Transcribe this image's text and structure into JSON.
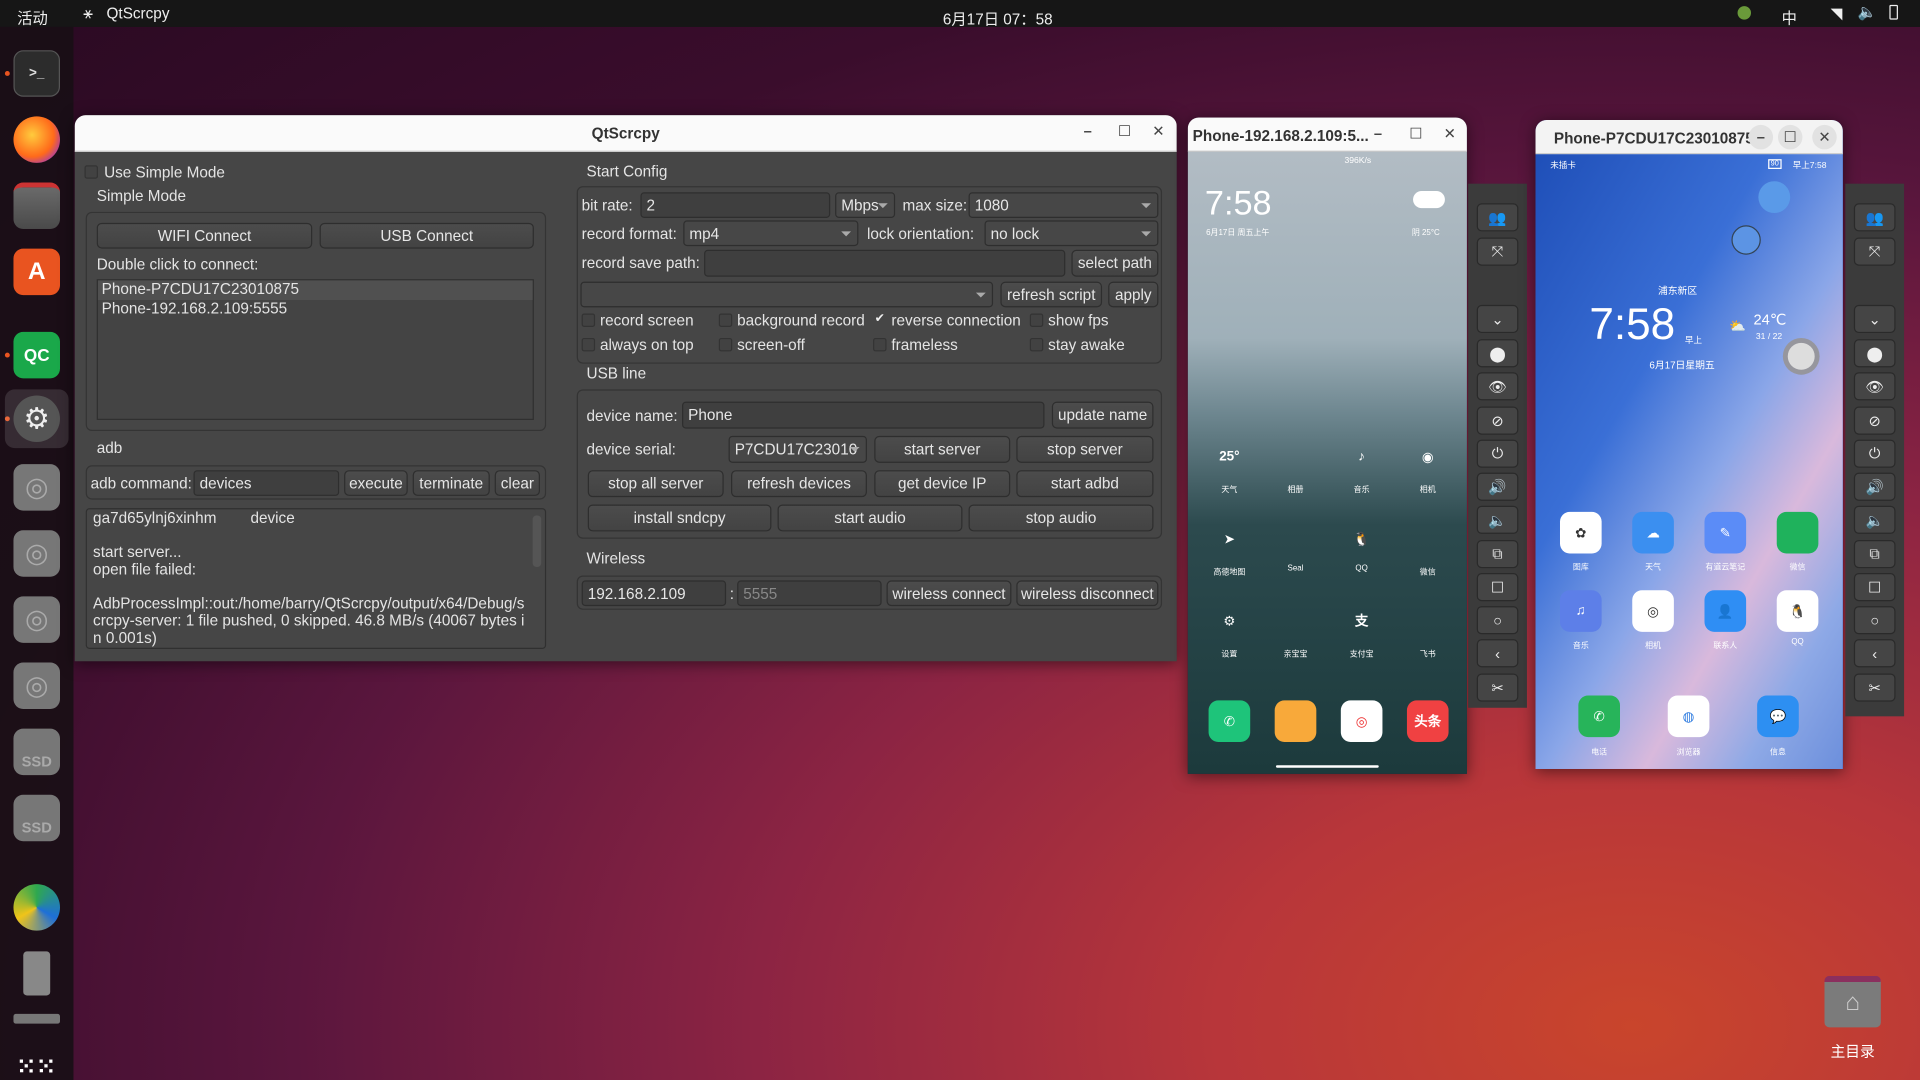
{
  "topbar": {
    "activities": "活动",
    "app_name": "QtScrcpy",
    "clock": "6月17日  07：58",
    "input_method": "中"
  },
  "dock": {
    "items": [
      "terminal",
      "firefox",
      "files",
      "app-center",
      "qtscrcpy",
      "settings",
      "disk",
      "disk",
      "disk",
      "disk",
      "ssd",
      "ssd",
      "app",
      "tablet",
      "drive",
      "show-apps"
    ],
    "ssd_label": "SSD",
    "qc_label": "QC"
  },
  "main_window": {
    "title": "QtScrcpy",
    "use_simple_mode": {
      "label": "Use Simple Mode",
      "checked": false
    },
    "simple_mode": {
      "title": "Simple Mode",
      "wifi_connect": "WIFI Connect",
      "usb_connect": "USB Connect",
      "hint": "Double click to connect:",
      "devices": [
        "Phone-P7CDU17C23010875",
        "Phone-192.168.2.109:5555"
      ]
    },
    "adb": {
      "title": "adb",
      "command_label": "adb command:",
      "command_value": "devices",
      "execute": "execute",
      "terminate": "terminate",
      "clear": "clear",
      "log": [
        "ga7d65ylnj6xinhm        device",
        "",
        "start server...",
        "open file failed:",
        "",
        "AdbProcessImpl::out:/home/barry/QtScrcpy/output/x64/Debug/scrcpy-server: 1 file pushed, 0 skipped. 46.8 MB/s (40067 bytes in 0.001s)"
      ]
    },
    "start_config": {
      "title": "Start Config",
      "bit_rate_label": "bit rate:",
      "bit_rate_value": "2",
      "bit_rate_unit": "Mbps",
      "max_size_label": "max size:",
      "max_size_value": "1080",
      "record_format_label": "record format:",
      "record_format_value": "mp4",
      "lock_orientation_label": "lock orientation:",
      "lock_orientation_value": "no lock",
      "record_save_path_label": "record save path:",
      "record_save_path_value": "",
      "select_path": "select path",
      "script_value": "",
      "refresh_script": "refresh script",
      "apply": "apply",
      "options": [
        {
          "label": "record screen",
          "checked": false
        },
        {
          "label": "background record",
          "checked": false
        },
        {
          "label": "reverse connection",
          "checked": true
        },
        {
          "label": "show fps",
          "checked": false
        },
        {
          "label": "always on top",
          "checked": false
        },
        {
          "label": "screen-off",
          "checked": false
        },
        {
          "label": "frameless",
          "checked": false
        },
        {
          "label": "stay awake",
          "checked": false
        }
      ]
    },
    "usb_line": {
      "title": "USB line",
      "device_name_label": "device name:",
      "device_name_value": "Phone",
      "update_name": "update name",
      "device_serial_label": "device serial:",
      "device_serial_value": "P7CDU17C23010",
      "start_server": "start server",
      "stop_server": "stop server",
      "stop_all_server": "stop all server",
      "refresh_devices": "refresh devices",
      "get_device_ip": "get device IP",
      "start_adbd": "start adbd",
      "install_sndcpy": "install sndcpy",
      "start_audio": "start audio",
      "stop_audio": "stop audio"
    },
    "wireless": {
      "title": "Wireless",
      "ip_value": "192.168.2.109",
      "separator": ":",
      "port_placeholder": "5555",
      "connect": "wireless connect",
      "disconnect": "wireless disconnect"
    }
  },
  "phone1": {
    "title": "Phone-192.168.2.109:5...",
    "status": "396K/s",
    "time": "7:58",
    "date": "6月17日 周五上午",
    "weather": "阴  25°C",
    "apps": [
      {
        "label": "天气",
        "glyph": "25°",
        "color": "#3d9cf5"
      },
      {
        "label": "相册",
        "glyph": "",
        "color": "#8fa6f2"
      },
      {
        "label": "音乐",
        "glyph": "♪",
        "color": "#e9f3f2"
      },
      {
        "label": "相机",
        "glyph": "◉",
        "color": "#e8e8ee"
      },
      {
        "label": "高德地图",
        "glyph": "➤",
        "color": "#f4f4f4"
      },
      {
        "label": "Seal",
        "glyph": "",
        "color": "#3475f0"
      },
      {
        "label": "QQ",
        "glyph": "🐧",
        "color": "#ffffff"
      },
      {
        "label": "微信",
        "glyph": "",
        "color": "#1fb25c"
      },
      {
        "label": "设置",
        "glyph": "⚙",
        "color": "#93a0b0"
      },
      {
        "label": "亲宝宝",
        "glyph": "",
        "color": "#f79a12"
      },
      {
        "label": "支付宝",
        "glyph": "支",
        "color": "#1677ff"
      },
      {
        "label": "飞书",
        "glyph": "",
        "color": "#ffffff"
      }
    ],
    "dock": [
      {
        "glyph": "✆",
        "color": "#1ec47a"
      },
      {
        "glyph": "",
        "color": "#f8a93a"
      },
      {
        "glyph": "◎",
        "color": "#ffffff"
      },
      {
        "glyph": "头条",
        "color": "#f04142"
      }
    ]
  },
  "phone2": {
    "title": "Phone-P7CDU17C23010875",
    "status_left": "未插卡",
    "status_right": "早上7:58",
    "battery": "90",
    "location": "浦东新区",
    "time": "7:58",
    "ampm": "早上",
    "date": "6月17日星期五",
    "temp": "24℃",
    "range": "31 / 22",
    "apps": [
      {
        "label": "图库",
        "glyph": "✿",
        "color": "#ffffff"
      },
      {
        "label": "天气",
        "glyph": "☁",
        "color": "#3b8ff0"
      },
      {
        "label": "有道云笔记",
        "glyph": "✎",
        "color": "#5b8cf7"
      },
      {
        "label": "微信",
        "glyph": "",
        "color": "#1fb25c"
      },
      {
        "label": "音乐",
        "glyph": "♫",
        "color": "#5d7fe8"
      },
      {
        "label": "相机",
        "glyph": "◎",
        "color": "#ffffff"
      },
      {
        "label": "联系人",
        "glyph": "👤",
        "color": "#2f8ef4"
      },
      {
        "label": "QQ",
        "glyph": "🐧",
        "color": "#ffffff"
      }
    ],
    "dock": [
      {
        "label": "电话",
        "glyph": "✆",
        "color": "#27b45a"
      },
      {
        "label": "浏览器",
        "glyph": "◍",
        "color": "#ffffff"
      },
      {
        "label": "信息",
        "glyph": "💬",
        "color": "#2d8ff2"
      }
    ]
  },
  "toolbar_icons": [
    "group-control",
    "fullscreen",
    "expand",
    "home",
    "show",
    "hide",
    "power",
    "volume-up",
    "volume-down",
    "app-switch",
    "menu",
    "home-circle",
    "back",
    "screenshot"
  ],
  "desktop": {
    "home_folder": "主目录"
  },
  "colors": {
    "accent": "#e95420",
    "group_control": "#118811",
    "qt_panel": "#464646"
  }
}
